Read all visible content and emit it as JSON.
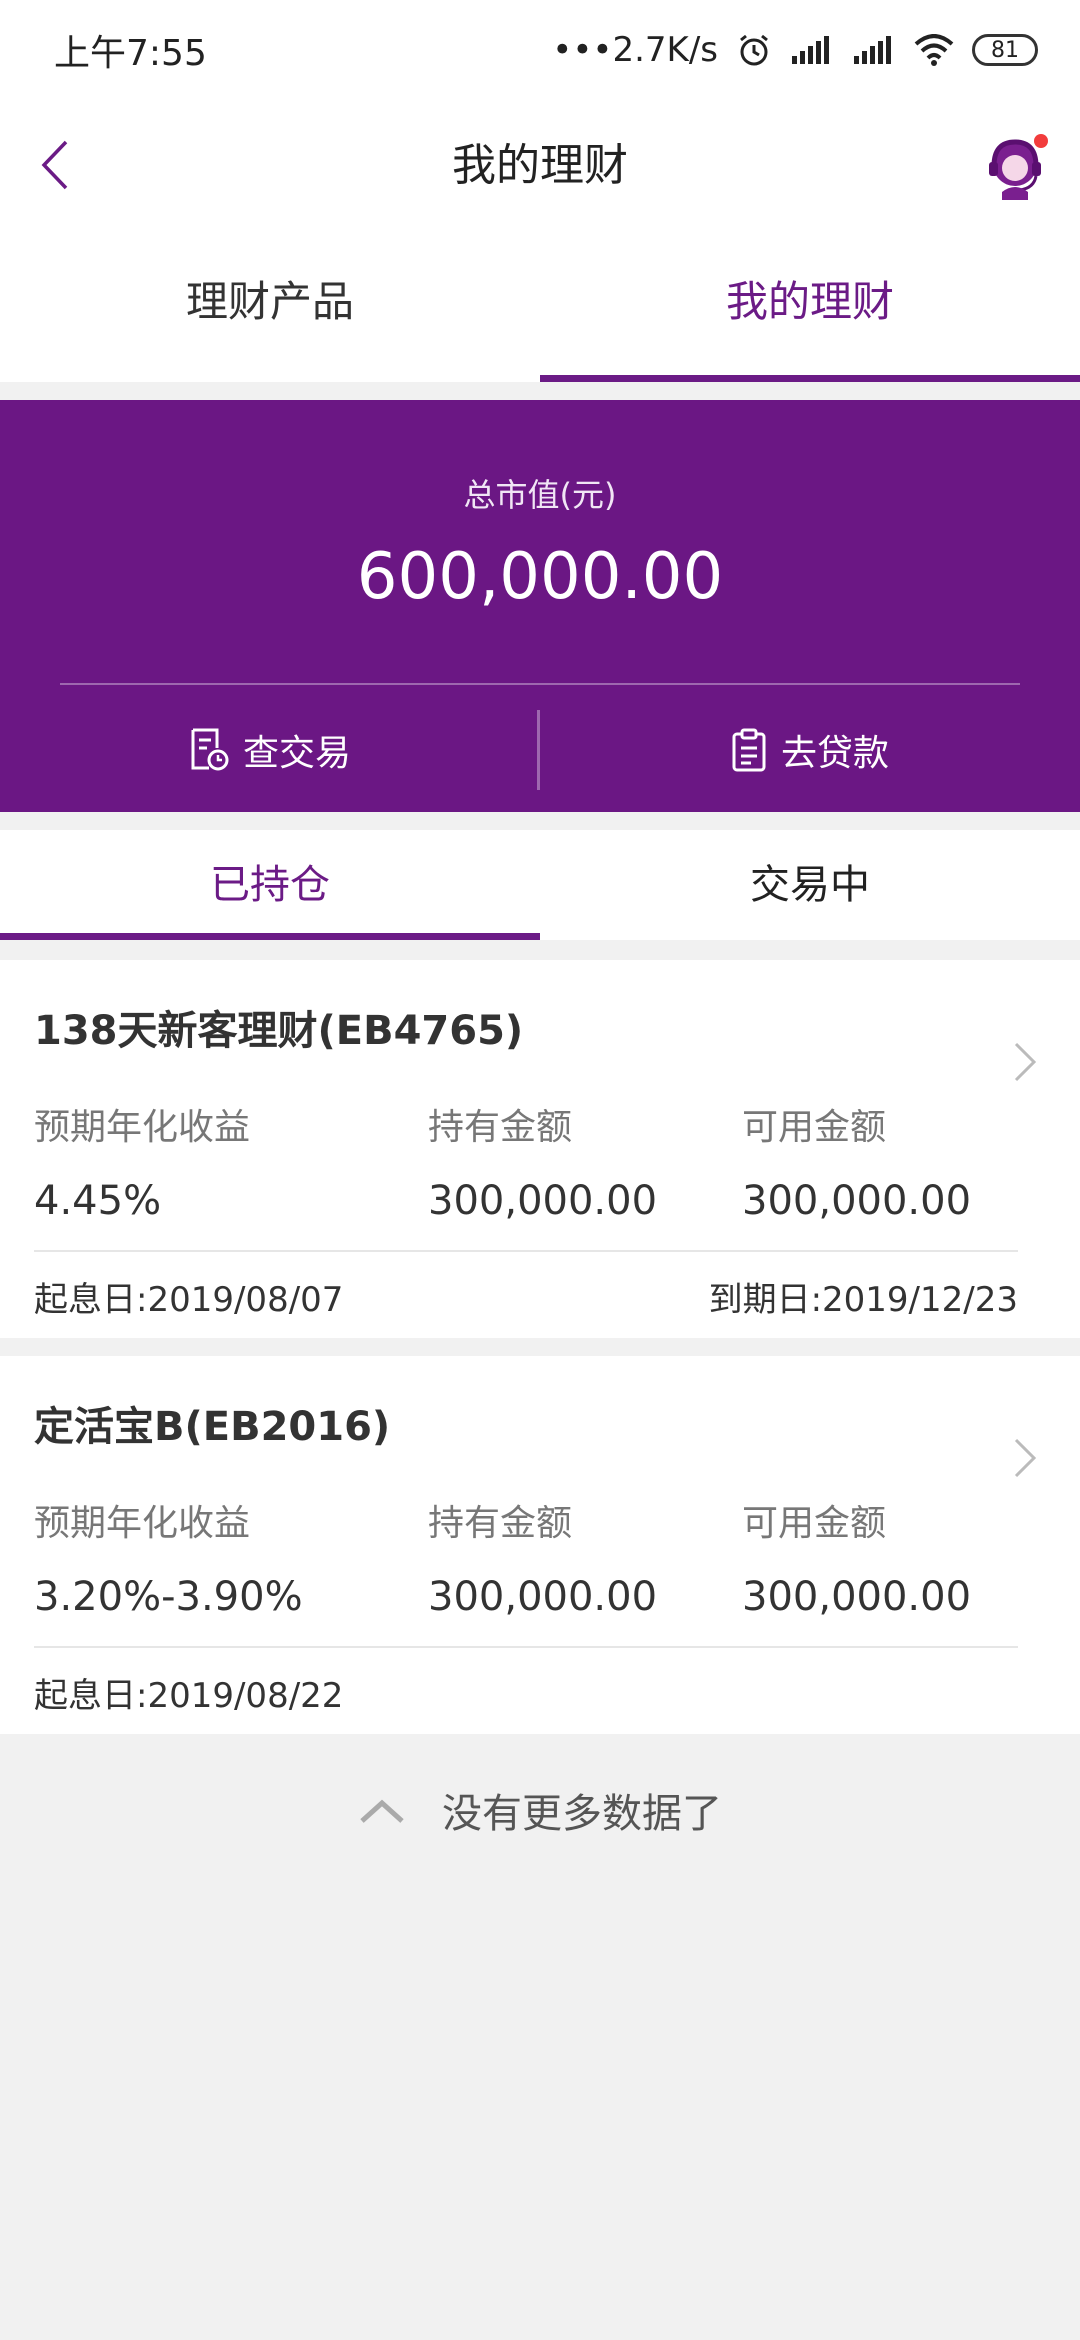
{
  "status_bar": {
    "time": "上午7:55",
    "network_speed": "•••2.7K/s",
    "battery": "81",
    "icons": [
      "alarm-icon",
      "signal-icon",
      "signal-icon",
      "wifi-icon",
      "battery-icon"
    ]
  },
  "nav": {
    "title": "我的理财",
    "back_icon": "chevron-left-icon",
    "service_icon": "customer-service-icon"
  },
  "top_tabs": [
    {
      "label": "理财产品",
      "active": false
    },
    {
      "label": "我的理财",
      "active": true
    }
  ],
  "summary": {
    "label": "总市值(元)",
    "value": "600,000.00",
    "actions": [
      {
        "label": "查交易",
        "icon": "transaction-record-icon"
      },
      {
        "label": "去贷款",
        "icon": "clipboard-icon"
      }
    ]
  },
  "sub_tabs": [
    {
      "label": "已持仓",
      "active": true
    },
    {
      "label": "交易中",
      "active": false
    }
  ],
  "holdings": [
    {
      "title": "138天新客理财(EB4765)",
      "yield_label": "预期年化收益",
      "yield_value": "4.45%",
      "held_label": "持有金额",
      "held_value": "300,000.00",
      "avail_label": "可用金额",
      "avail_value": "300,000.00",
      "start_date": "起息日:2019/08/07",
      "end_date": "到期日:2019/12/23"
    },
    {
      "title": "定活宝B(EB2016)",
      "yield_label": "预期年化收益",
      "yield_value": "3.20%-3.90%",
      "held_label": "持有金额",
      "held_value": "300,000.00",
      "avail_label": "可用金额",
      "avail_value": "300,000.00",
      "start_date": "起息日:2019/08/22"
    }
  ],
  "footer": {
    "no_more_text": "没有更多数据了"
  },
  "colors": {
    "accent": "#6b1b86",
    "hero_bg": "#6b1784",
    "page_bg": "#f1f1f1"
  }
}
